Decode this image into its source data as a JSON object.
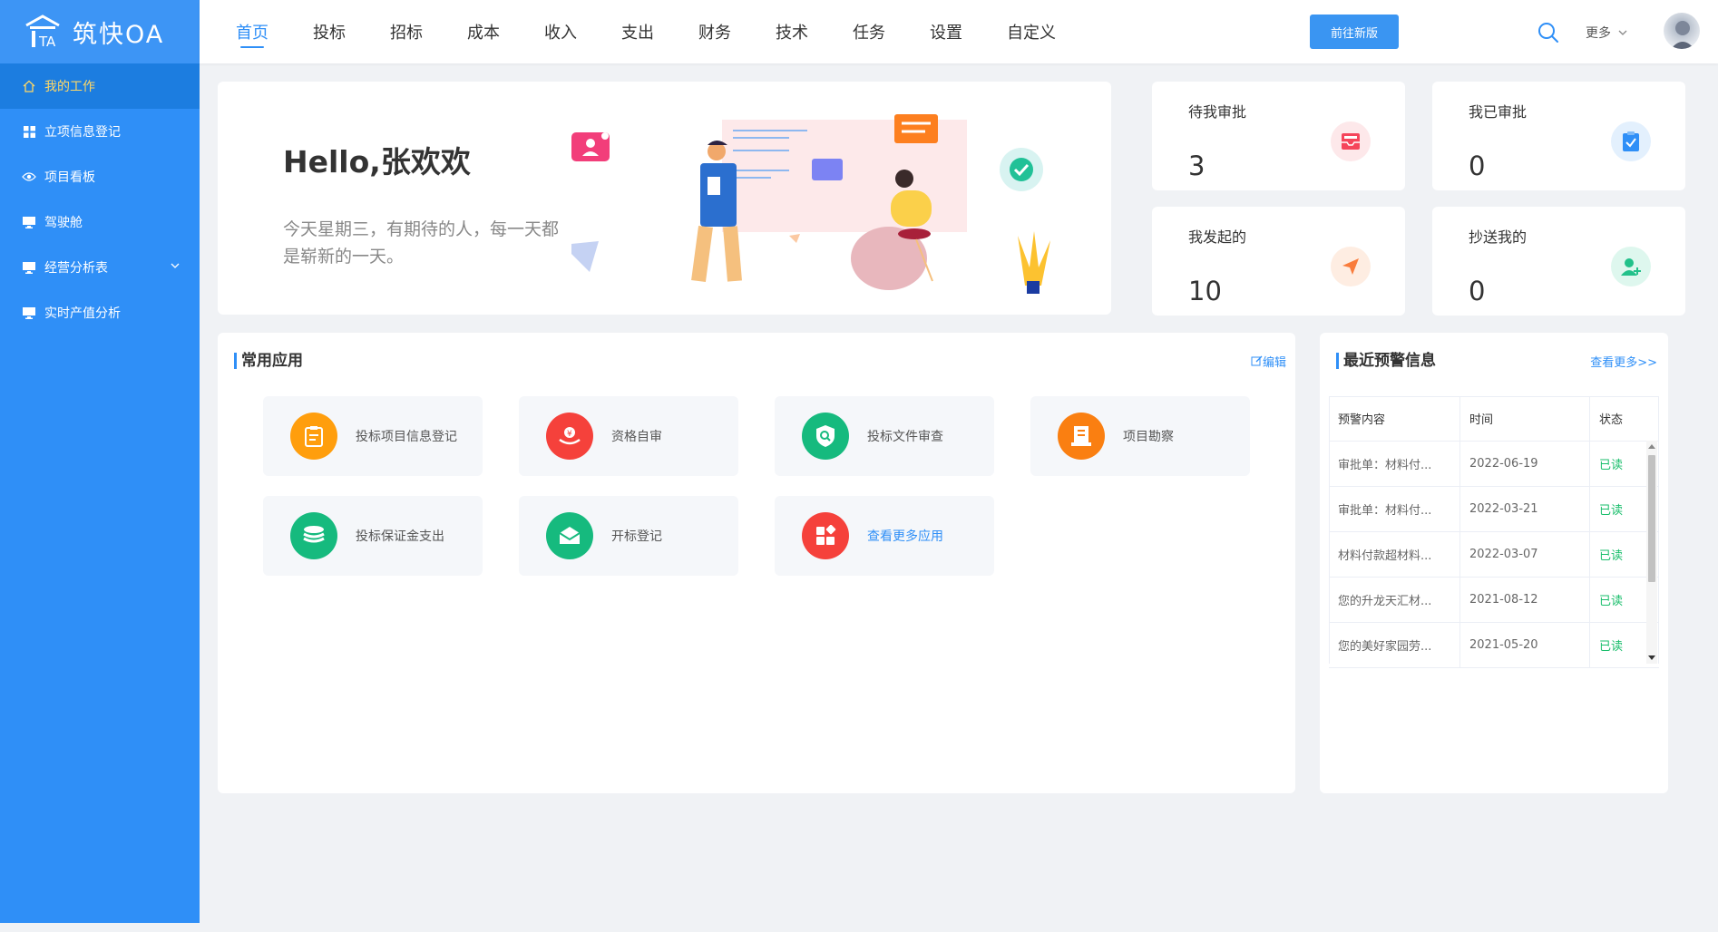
{
  "app": {
    "name": "筑快OA"
  },
  "sidebar": {
    "items": [
      {
        "label": "我的工作",
        "icon": "home-icon",
        "active": true
      },
      {
        "label": "立项信息登记",
        "icon": "grid-icon"
      },
      {
        "label": "项目看板",
        "icon": "eye-icon"
      },
      {
        "label": "驾驶舱",
        "icon": "monitor-icon"
      },
      {
        "label": "经营分析表",
        "icon": "monitor-icon",
        "expandable": true
      },
      {
        "label": "实时产值分析",
        "icon": "monitor-icon"
      }
    ]
  },
  "topnav": {
    "items": [
      "首页",
      "投标",
      "招标",
      "成本",
      "收入",
      "支出",
      "财务",
      "技术",
      "任务",
      "设置",
      "自定义"
    ],
    "active": "首页",
    "new_version_btn": "前往新版",
    "more": "更多"
  },
  "welcome": {
    "hello": "Hello,张欢欢",
    "subtitle": "今天星期三，有期待的人，每一天都是崭新的一天。"
  },
  "stats": [
    {
      "label": "待我审批",
      "value": "3",
      "icon": "inbox-icon",
      "color": "#f5455b",
      "bg": "#fde8ea"
    },
    {
      "label": "我已审批",
      "value": "0",
      "icon": "check-clipboard-icon",
      "color": "#2f8ff7",
      "bg": "#e3f0fd"
    },
    {
      "label": "我发起的",
      "value": "10",
      "icon": "send-icon",
      "color": "#f97c3c",
      "bg": "#feede2"
    },
    {
      "label": "抄送我的",
      "value": "0",
      "icon": "add-user-icon",
      "color": "#22c18a",
      "bg": "#def7ee"
    }
  ],
  "apps": {
    "title": "常用应用",
    "edit": "编辑",
    "items": [
      {
        "label": "投标项目信息登记",
        "icon": "clipboard-icon",
        "color": "#ff9e0d"
      },
      {
        "label": "资格自审",
        "icon": "hand-coin-icon",
        "color": "#f5413b"
      },
      {
        "label": "投标文件审查",
        "icon": "shield-search-icon",
        "color": "#16ba7e"
      },
      {
        "label": "项目勘察",
        "icon": "document-icon",
        "color": "#fa7f11"
      },
      {
        "label": "投标保证金支出",
        "icon": "coins-icon",
        "color": "#16ba7e"
      },
      {
        "label": "开标登记",
        "icon": "envelope-icon",
        "color": "#16ba7e"
      },
      {
        "label": "查看更多应用",
        "icon": "apps-icon",
        "color": "#f5413b",
        "link": true
      }
    ]
  },
  "warnings": {
    "title": "最近预警信息",
    "more": "查看更多>>",
    "columns": [
      "预警内容",
      "时间",
      "状态"
    ],
    "rows": [
      {
        "content": "审批单：材料付...",
        "time": "2022-06-19",
        "status": "已读"
      },
      {
        "content": "审批单：材料付...",
        "time": "2022-03-21",
        "status": "已读"
      },
      {
        "content": "材料付款超材料...",
        "time": "2022-03-07",
        "status": "已读"
      },
      {
        "content": "您的升龙天汇材...",
        "time": "2021-08-12",
        "status": "已读"
      },
      {
        "content": "您的美好家园劳...",
        "time": "2021-05-20",
        "status": "已读"
      }
    ]
  }
}
